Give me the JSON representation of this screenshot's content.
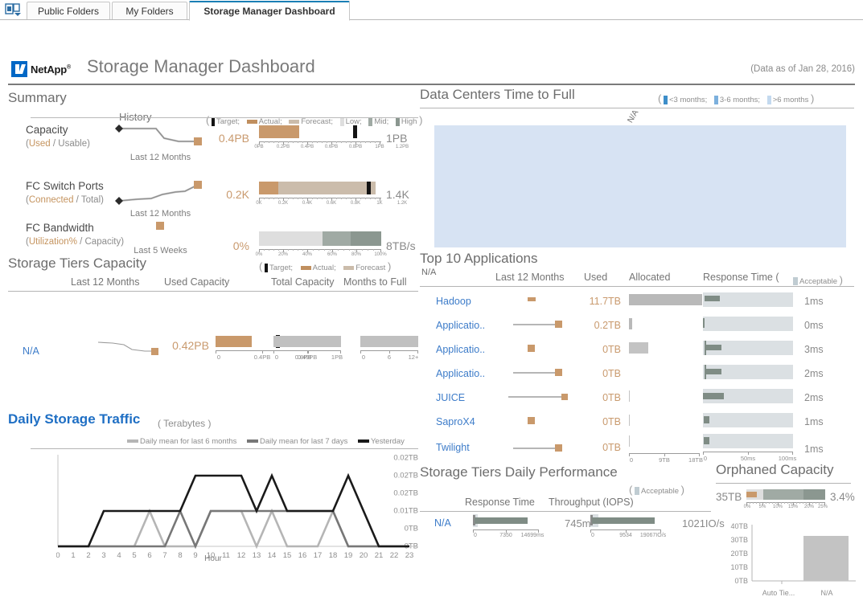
{
  "browser_tabs": {
    "icon": "folder-tabs-icon",
    "items": [
      {
        "label": "Public Folders",
        "active": false
      },
      {
        "label": "My Folders",
        "active": false
      },
      {
        "label": "Storage Manager Dashboard",
        "active": true
      }
    ]
  },
  "header": {
    "brand": "NetApp",
    "brand_sup": "®",
    "title": "Storage Manager Dashboard",
    "data_as_of": "(Data as of Jan 28, 2016)"
  },
  "colors": {
    "accent_blue": "#1a7fb5",
    "link_blue": "#3d7cc9",
    "actual_tan": "#c9996b",
    "forecast_tan": "#cbbcab",
    "target_black": "#141414",
    "band_low": "#dedede",
    "band_mid": "#a0aaa4",
    "band_high": "#8b9790",
    "panel_blue": "#d7e3f3",
    "bar_gray": "#c0c0c0",
    "dark_gray": "#9e9e9e"
  },
  "summary": {
    "title": "Summary",
    "history_header": "History",
    "legend": {
      "open": "(",
      "close": ")",
      "items": [
        {
          "label": "Target;",
          "swatch": "target-bar"
        },
        {
          "label": "Actual;",
          "swatch": "actual-bar"
        },
        {
          "label": "Forecast;",
          "swatch": "forecast-bar"
        },
        {
          "label": "Low;",
          "swatch": "low-band"
        },
        {
          "label": "Mid;",
          "swatch": "mid-band"
        },
        {
          "label": "High",
          "swatch": "high-band"
        }
      ]
    },
    "rows": [
      {
        "name": "Capacity",
        "sub_measure": "Used",
        "sub_rest": " / Usable)",
        "sub_open": "(",
        "spark_label": "Last 12 Months",
        "left_value": "0.4PB",
        "right_value": "1PB",
        "bullet": {
          "actual_pct": 33,
          "forecast_pct": 0,
          "target_pct": 77,
          "bands": [],
          "axis": [
            "0PB",
            "0.2PB",
            "0.4PB",
            "0.6PB",
            "0.8PB",
            "1PB",
            "1.2PB"
          ]
        }
      },
      {
        "name": "FC Switch Ports",
        "sub_measure": "Connected",
        "sub_rest": " / Total)",
        "sub_open": "(",
        "spark_label": "Last 12 Months",
        "left_value": "0.2K",
        "right_value": "1.4K",
        "bullet": {
          "actual_pct": 16,
          "forecast_pct": 100,
          "target_pct": 93,
          "bands": [],
          "axis": [
            "0K",
            "0.2K",
            "0.4K",
            "0.6K",
            "0.8K",
            "1K",
            "1.2K"
          ]
        }
      },
      {
        "name": "FC Bandwidth",
        "sub_measure": "Utilization%",
        "sub_rest": " / Capacity)",
        "sub_open": "(",
        "spark_label": "Last 5 Weeks",
        "left_value": "0%",
        "right_value": "8TB/s",
        "bullet": {
          "actual_pct": 0,
          "forecast_pct": 0,
          "target_pct": -1,
          "bands": [
            {
              "to": 52,
              "level": "low"
            },
            {
              "to": 75,
              "level": "mid"
            },
            {
              "to": 100,
              "level": "high"
            }
          ],
          "axis": [
            "0%",
            "20%",
            "40%",
            "60%",
            "80%",
            "100%"
          ]
        }
      }
    ]
  },
  "data_centers": {
    "title": "Data Centers Time to Full",
    "legend": {
      "open": "(",
      "close": ")",
      "items": [
        {
          "label": "<3 months;",
          "swatch": "lt3-months"
        },
        {
          "label": "3-6 months;",
          "swatch": "3to6-months"
        },
        {
          "label": ">6 months",
          "swatch": "gt6-months"
        }
      ]
    },
    "top_label": "N/A",
    "left_label": "N/A"
  },
  "storage_tiers": {
    "title": "Storage Tiers Capacity",
    "legend": {
      "open": "(",
      "close": ")",
      "items": [
        {
          "label": "Target;",
          "swatch": "target-bar"
        },
        {
          "label": "Actual;",
          "swatch": "actual-bar"
        },
        {
          "label": "Forecast",
          "swatch": "forecast-bar"
        }
      ]
    },
    "columns": [
      "Last 12 Months",
      "Used Capacity",
      "Total Capacity",
      "Months to Full"
    ],
    "row": {
      "tier_name": "N/A",
      "used_value": "0.42PB",
      "used_axis": [
        "0",
        "0.4PB",
        "0.8PB"
      ],
      "used_actual_pct": 52,
      "used_target_pct": 86,
      "total_axis": [
        "0",
        "0.49PB",
        "1PB"
      ],
      "total_pct": 100,
      "months_axis": [
        "0",
        "6",
        "12+"
      ],
      "months_pct": 100
    }
  },
  "daily_traffic": {
    "title": "Daily Storage Traffic",
    "unit": "( Terabytes )",
    "legend": [
      {
        "label": "Daily mean for last 6 months",
        "color": "#b5b5b5"
      },
      {
        "label": "Daily mean for last 7 days",
        "color": "#777777"
      },
      {
        "label": "Yesterday",
        "color": "#1a1a1a"
      }
    ],
    "xlabel": "Hour"
  },
  "chart_data": [
    {
      "type": "line",
      "id": "daily-storage-traffic",
      "title": "Daily Storage Traffic",
      "subtitle": "( Terabytes )",
      "xlabel": "Hour",
      "ylabel": "",
      "grid": false,
      "legend_position": "top",
      "x": [
        0,
        1,
        2,
        3,
        4,
        5,
        6,
        7,
        8,
        9,
        10,
        11,
        12,
        13,
        14,
        15,
        16,
        17,
        18,
        19,
        20,
        21,
        22,
        23
      ],
      "ytick_labels": [
        "0.02TB",
        "0.02TB",
        "0.02TB",
        "0.01TB",
        "0TB",
        "0TB"
      ],
      "ytick_values": [
        0.025,
        0.02,
        0.015,
        0.01,
        0.005,
        0
      ],
      "ylim": [
        0,
        0.025
      ],
      "series": [
        {
          "name": "Daily mean for last 6 months",
          "color": "#b5b5b5",
          "values": [
            0,
            0,
            0,
            0,
            0,
            0.01,
            0,
            0,
            0,
            0.01,
            0.01,
            0.01,
            0,
            0.01,
            0,
            0,
            0,
            0.01,
            0,
            0,
            0,
            0,
            0,
            0
          ]
        },
        {
          "name": "Daily mean for last 7 days",
          "color": "#777777",
          "values": [
            0,
            0,
            0,
            0,
            0,
            0,
            0,
            0.01,
            0,
            0.01,
            0.01,
            0.01,
            0.01,
            0.01,
            0.01,
            0.01,
            0.01,
            0.01,
            0,
            0,
            0,
            0,
            0,
            0
          ]
        },
        {
          "name": "Yesterday",
          "color": "#1a1a1a",
          "values": [
            0,
            0,
            0,
            0.01,
            0.01,
            0.01,
            0.01,
            0.01,
            0.01,
            0.02,
            0.02,
            0.02,
            0.01,
            0.02,
            0.01,
            0.01,
            0.01,
            0.02,
            0.01,
            0,
            0,
            0,
            0,
            0
          ]
        }
      ]
    },
    {
      "type": "bar",
      "id": "orphaned-capacity-bar",
      "title": "Orphaned Capacity",
      "categories": [
        "Auto Tie...",
        "N/A"
      ],
      "values": [
        0,
        33
      ],
      "ytick_labels": [
        "0TB",
        "10TB",
        "20TB",
        "30TB",
        "40TB"
      ],
      "ylim": [
        0,
        40
      ],
      "ylabel": "",
      "xlabel": ""
    }
  ],
  "applications": {
    "title": "Top 10 Applications",
    "columns": [
      "Last 12 Months",
      "Used",
      "Allocated",
      "Response Time ("
    ],
    "legend_label": "Acceptable",
    "legend_close": ")",
    "alloc_axis": [
      "0",
      "9TB",
      "18TB"
    ],
    "rt_axis": [
      "0",
      "50ms",
      "100ms"
    ],
    "rows": [
      {
        "name": "Hadoop",
        "used": "11.7TB",
        "alloc_pct": 65,
        "rt_pct": 7,
        "rt_start": 3,
        "rt_value": "1ms",
        "spark": "flat-high"
      },
      {
        "name": "Applicatio..",
        "used": "0.2TB",
        "alloc_pct": 2,
        "rt_pct": 1,
        "rt_start": 0,
        "rt_value": "0ms",
        "spark": "rise"
      },
      {
        "name": "Applicatio..",
        "used": "0TB",
        "alloc_pct": 17,
        "rt_pct": 19,
        "rt_start": 2,
        "rt_value": "3ms",
        "spark": "flat-mid"
      },
      {
        "name": "Applicatio..",
        "used": "0TB",
        "alloc_pct": 0,
        "rt_pct": 19,
        "rt_start": 2,
        "rt_value": "2ms",
        "spark": "rise"
      },
      {
        "name": "JUICE",
        "used": "0TB",
        "alloc_pct": 1,
        "rt_pct": 24,
        "rt_start": 0,
        "rt_value": "2ms",
        "spark": "rise-long"
      },
      {
        "name": "SaproX4",
        "used": "0TB",
        "alloc_pct": 1,
        "rt_pct": 6,
        "rt_start": 1,
        "rt_value": "1ms",
        "spark": "flat-mid"
      },
      {
        "name": "Twilight",
        "used": "0TB",
        "alloc_pct": 1,
        "rt_pct": 6,
        "rt_start": 1,
        "rt_value": "1ms",
        "spark": "rise"
      }
    ]
  },
  "tiers_performance": {
    "title": "Storage Tiers Daily Performance",
    "legend_open": "(",
    "legend_label": "Acceptable",
    "legend_close": ")",
    "columns": [
      "Response Time",
      "Throughput (IOPS)"
    ],
    "row_label": "N/A",
    "response": {
      "value": "745ms",
      "axis": [
        "0",
        "7350",
        "14699ms"
      ],
      "bar_pct": 62,
      "marker_pct": 2
    },
    "throughput": {
      "value": "1021IO/s",
      "axis": [
        "0",
        "9534",
        "19067IO/s"
      ],
      "bar_pct": 88,
      "marker_pct": 5
    }
  },
  "orphaned": {
    "title": "Orphaned Capacity",
    "left_value": "35TB",
    "right_value": "3.4%",
    "bar": {
      "actual_pct": 13,
      "bands": [
        {
          "to": 21,
          "level": "low"
        },
        {
          "to": 72,
          "level": "mid"
        },
        {
          "to": 100,
          "level": "high"
        }
      ],
      "axis": [
        "0%",
        "5%",
        "10%",
        "15%",
        "20%",
        "25%"
      ]
    },
    "chart_ticks": [
      "40TB",
      "30TB",
      "20TB",
      "10TB",
      "0TB"
    ],
    "chart_categories": [
      "Auto Tie...",
      "N/A"
    ]
  }
}
